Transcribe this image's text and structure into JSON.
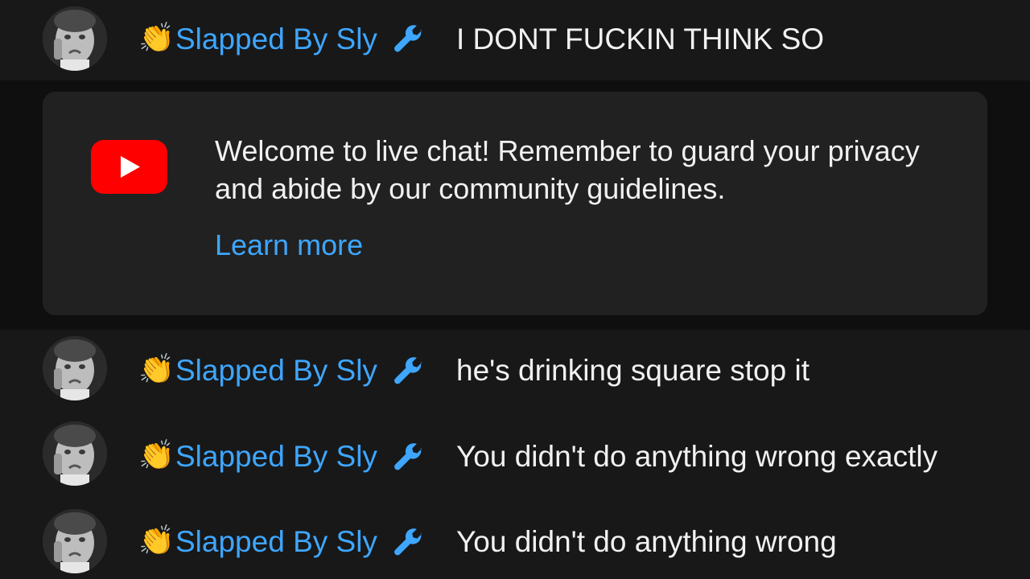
{
  "messages": [
    {
      "author": "Slapped By Sly",
      "badge_emoji": "👏",
      "moderator_icon": "wrench-icon",
      "text": "I DONT FUCKIN THINK SO"
    },
    {
      "author": "Slapped By Sly",
      "badge_emoji": "👏",
      "moderator_icon": "wrench-icon",
      "text": "he's drinking square stop it"
    },
    {
      "author": "Slapped By Sly",
      "badge_emoji": "👏",
      "moderator_icon": "wrench-icon",
      "text": "You didn't do anything wrong exactly"
    },
    {
      "author": "Slapped By Sly",
      "badge_emoji": "👏",
      "moderator_icon": "wrench-icon",
      "text": "You didn't do anything wrong"
    }
  ],
  "banner": {
    "icon": "youtube-logo-icon",
    "text": "Welcome to live chat! Remember to guard your privacy and abide by our community guidelines.",
    "link": "Learn more"
  },
  "colors": {
    "background": "#181818",
    "banner_strip": "#0f0f0f",
    "banner_card": "#212121",
    "author": "#3ea6ff",
    "message_text": "#f1f1f1",
    "youtube_red": "#ff0000"
  }
}
